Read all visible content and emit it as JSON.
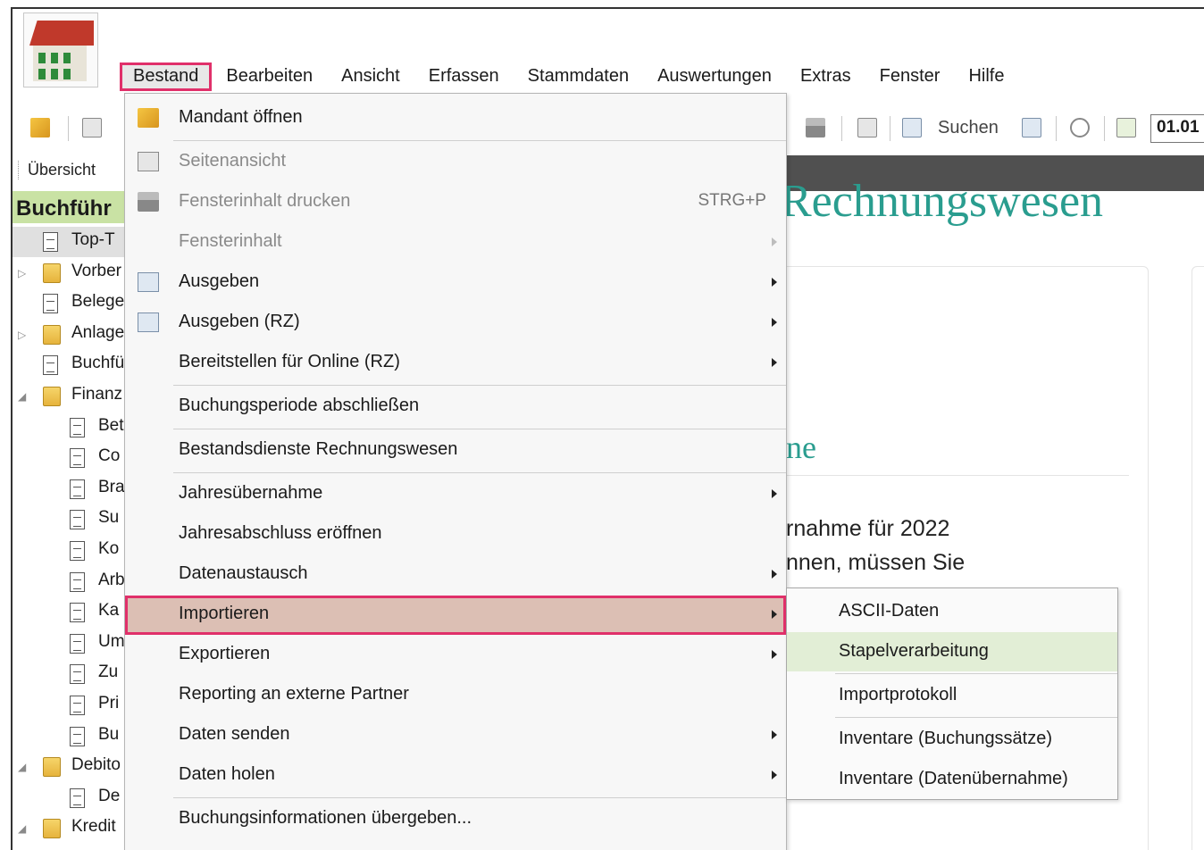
{
  "menubar": {
    "items": [
      "Bestand",
      "Bearbeiten",
      "Ansicht",
      "Erfassen",
      "Stammdaten",
      "Auswertungen",
      "Extras",
      "Fenster",
      "Hilfe"
    ]
  },
  "toolbar": {
    "search_label": "Suchen",
    "date_value": "01.01"
  },
  "tabs": {
    "overview": "Übersicht"
  },
  "tree": {
    "header": "Buchführ",
    "items": [
      {
        "label": "Top-T",
        "type": "doc",
        "level": 0,
        "expander": ""
      },
      {
        "label": "Vorber",
        "type": "folder",
        "level": 0,
        "expander": "▷"
      },
      {
        "label": "Belege",
        "type": "doc",
        "level": 0,
        "expander": ""
      },
      {
        "label": "Anlage",
        "type": "folder",
        "level": 0,
        "expander": "▷"
      },
      {
        "label": "Buchfü",
        "type": "doc",
        "level": 0,
        "expander": ""
      },
      {
        "label": "Finanz",
        "type": "folder",
        "level": 0,
        "expander": "◢"
      },
      {
        "label": "Bet",
        "type": "doc",
        "level": 1,
        "expander": ""
      },
      {
        "label": "Co",
        "type": "doc",
        "level": 1,
        "expander": ""
      },
      {
        "label": "Bra",
        "type": "doc",
        "level": 1,
        "expander": ""
      },
      {
        "label": "Su",
        "type": "doc",
        "level": 1,
        "expander": ""
      },
      {
        "label": "Ko",
        "type": "doc",
        "level": 1,
        "expander": ""
      },
      {
        "label": "Arb",
        "type": "doc",
        "level": 1,
        "expander": ""
      },
      {
        "label": "Ka",
        "type": "doc",
        "level": 1,
        "expander": ""
      },
      {
        "label": "Um",
        "type": "doc",
        "level": 1,
        "expander": ""
      },
      {
        "label": "Zu",
        "type": "doc",
        "level": 1,
        "expander": ""
      },
      {
        "label": "Pri",
        "type": "doc",
        "level": 1,
        "expander": ""
      },
      {
        "label": "Bu",
        "type": "doc",
        "level": 1,
        "expander": ""
      },
      {
        "label": "Debito",
        "type": "folder",
        "level": 0,
        "expander": "◢"
      },
      {
        "label": "De",
        "type": "doc",
        "level": 1,
        "expander": ""
      },
      {
        "label": "Kredit",
        "type": "folder",
        "level": 0,
        "expander": "◢"
      }
    ]
  },
  "main": {
    "heading": "Rechnungswesen",
    "subheading": "ne",
    "lines": [
      "rnahme für 2022",
      "nnen, müssen Sie"
    ]
  },
  "dropdown": {
    "items": [
      {
        "label": "Mandant öffnen",
        "icon": "folder-open-icon",
        "disabled": false,
        "submenu": false,
        "shortcut": ""
      },
      {
        "label": "Seitenansicht",
        "icon": "page-preview-icon",
        "disabled": true,
        "submenu": false,
        "shortcut": ""
      },
      {
        "label": "Fensterinhalt drucken",
        "icon": "printer-icon",
        "disabled": true,
        "submenu": false,
        "shortcut": "STRG+P"
      },
      {
        "label": "Fensterinhalt",
        "icon": "",
        "disabled": true,
        "submenu": true,
        "shortcut": ""
      },
      {
        "label": "Ausgeben",
        "icon": "output-icon",
        "disabled": false,
        "submenu": true,
        "shortcut": ""
      },
      {
        "label": "Ausgeben (RZ)",
        "icon": "output-rz-icon",
        "disabled": false,
        "submenu": true,
        "shortcut": ""
      },
      {
        "label": "Bereitstellen für Online (RZ)",
        "icon": "",
        "disabled": false,
        "submenu": true,
        "shortcut": ""
      },
      {
        "label": "Buchungsperiode abschließen",
        "icon": "",
        "disabled": false,
        "submenu": false,
        "shortcut": ""
      },
      {
        "label": "Bestandsdienste Rechnungswesen",
        "icon": "",
        "disabled": false,
        "submenu": false,
        "shortcut": ""
      },
      {
        "label": "Jahresübernahme",
        "icon": "",
        "disabled": false,
        "submenu": true,
        "shortcut": ""
      },
      {
        "label": "Jahresabschluss eröffnen",
        "icon": "",
        "disabled": false,
        "submenu": false,
        "shortcut": ""
      },
      {
        "label": "Datenaustausch",
        "icon": "",
        "disabled": false,
        "submenu": true,
        "shortcut": ""
      },
      {
        "label": "Importieren",
        "icon": "",
        "disabled": false,
        "submenu": true,
        "shortcut": ""
      },
      {
        "label": "Exportieren",
        "icon": "",
        "disabled": false,
        "submenu": true,
        "shortcut": ""
      },
      {
        "label": "Reporting an externe Partner",
        "icon": "",
        "disabled": false,
        "submenu": false,
        "shortcut": ""
      },
      {
        "label": "Daten senden",
        "icon": "",
        "disabled": false,
        "submenu": true,
        "shortcut": ""
      },
      {
        "label": "Daten holen",
        "icon": "",
        "disabled": false,
        "submenu": true,
        "shortcut": ""
      },
      {
        "label": "Buchungsinformationen übergeben...",
        "icon": "",
        "disabled": false,
        "submenu": false,
        "shortcut": ""
      }
    ],
    "highlighted": "Importieren"
  },
  "submenu": {
    "items": [
      "ASCII-Daten",
      "Stapelverarbeitung",
      "Importprotokoll",
      "Inventare (Buchungssätze)",
      "Inventare (Datenübernahme)"
    ],
    "hovered": "Stapelverarbeitung"
  },
  "colors": {
    "highlight_border": "#e0306a",
    "highlight_fill": "#dcbfb4",
    "hover_green": "#e2eed6",
    "tree_header": "#c9e2a4",
    "heading_teal": "#2a9d8f"
  }
}
